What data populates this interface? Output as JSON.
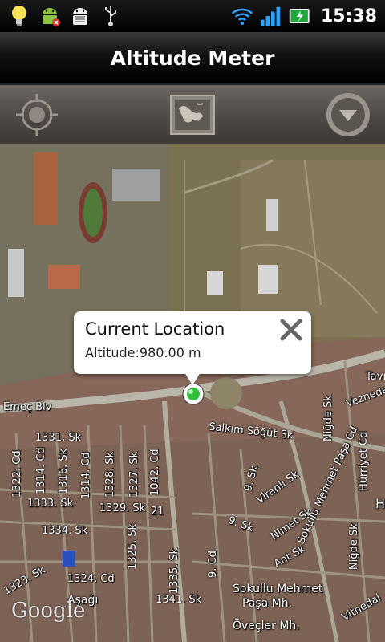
{
  "status_bar": {
    "time": "15:38",
    "icons": [
      "lightbulb-icon",
      "android-icon",
      "android-debug-icon",
      "usb-icon",
      "wifi-icon",
      "signal-icon",
      "battery-charging-icon"
    ]
  },
  "app": {
    "title": "Altitude Meter"
  },
  "toolbar": {
    "buttons": [
      "locate-icon",
      "map-view-icon",
      "dropdown-menu-icon"
    ]
  },
  "popup": {
    "title": "Current Location",
    "altitude": "Altitude:980.00 m"
  },
  "map": {
    "labels": {
      "emec": "Emeç Blv",
      "salkim": "Salkım Söğüt Sk",
      "sk1331": "1331. Sk",
      "sk1322": "1322. Cd",
      "sk1314": "1314. Cd",
      "sk1316": "1316. Sk",
      "sk1328": "1328. Sk",
      "sk1327": "1327. Sk",
      "sk1042": "1042. Cd",
      "sk1333": "1333. Sk",
      "sk1329": "1329. Sk",
      "sk21": "21",
      "sk1334": "1334. Sk",
      "sk1325": "1325. Sk",
      "sk1335": "1335. Sk",
      "sk1323": "1323. Sk",
      "sk1324": "1324. Cd",
      "sk1341": "1341. Sk",
      "sk9a": "9. Sk",
      "sk9b": "9. Sk",
      "sk9cd": "9. Cd",
      "viranli": "Viranlı Sk",
      "nimet": "Nimet Sk",
      "ant": "Ant Sk",
      "sokullu_cd": "Sokullu Mehmet Paşa Cd",
      "sokullu_mh1": "Sokullu Mehmet",
      "sokullu_mh2": "Paşa Mh.",
      "ovecler": "Öveçler Mh.",
      "asagi": "Aşağı",
      "nigde1": "Niğde Sk",
      "nigde2": "Niğde Sk",
      "hurriyet": "Hürriyet Cd",
      "vezneda": "Veznedar",
      "tavi": "Tavı",
      "vitnedal": "Vitnedal",
      "h": "H",
      "google": "Google"
    }
  }
}
